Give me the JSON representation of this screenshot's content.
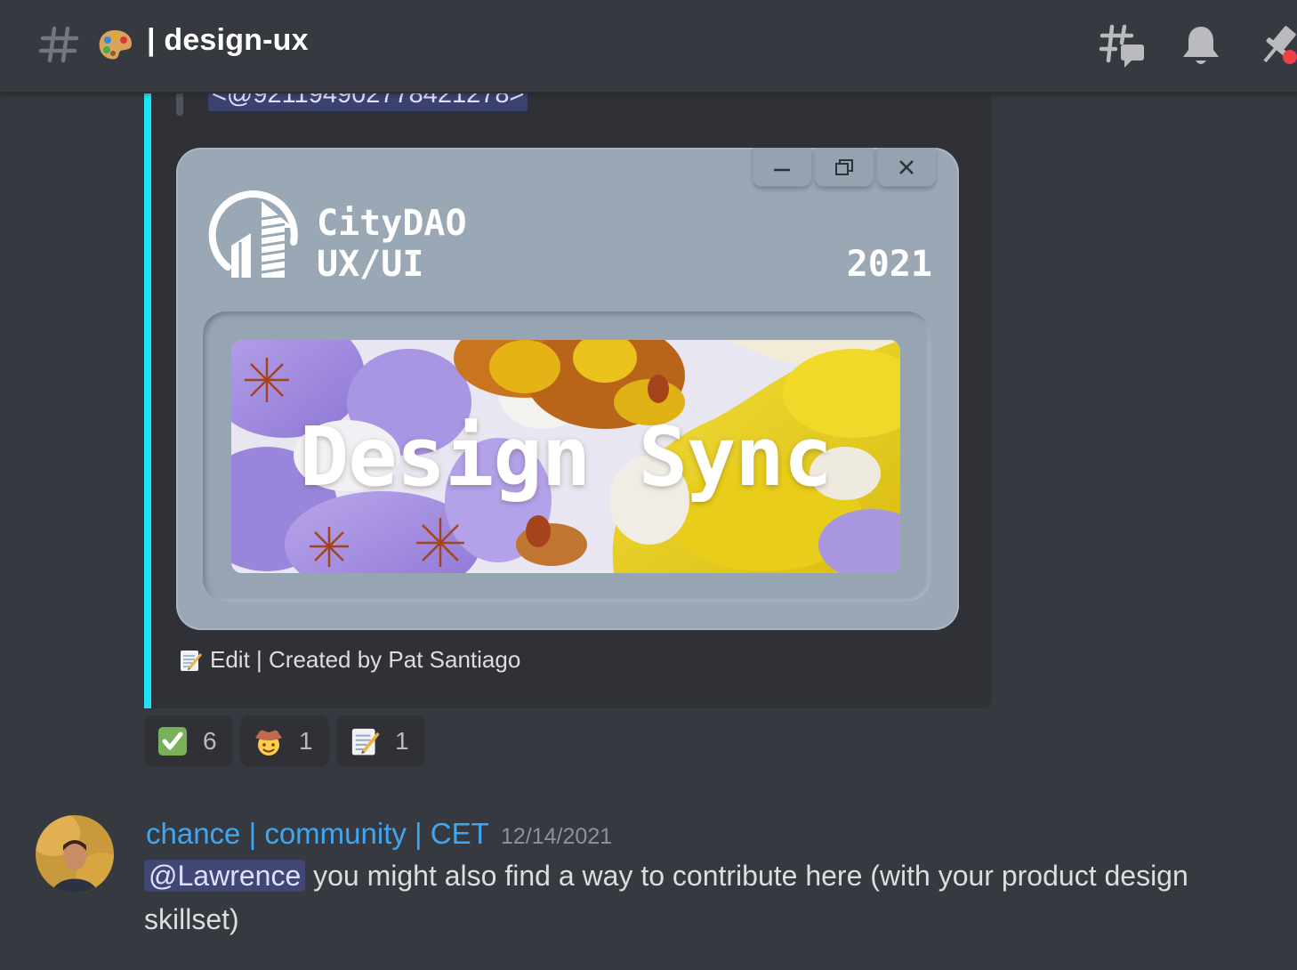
{
  "header": {
    "channel_label": "| design-ux",
    "icons": [
      "text-channel-hash-icon",
      "artist-palette-emoji",
      "threads-icon",
      "notification-bell-icon",
      "pinned-messages-icon"
    ]
  },
  "embed": {
    "accent_color": "#1de4f6",
    "mention_id": "<@921194902778421278>",
    "image": {
      "brand_line_1": "CityDAO",
      "brand_line_2": "UX/UI",
      "year": "2021",
      "banner_title": "Design Sync",
      "window_controls": [
        "minimize-icon",
        "restore-icon",
        "close-icon"
      ]
    },
    "footer_text": "Edit | Created by Pat Santiago",
    "footer_icon": "memo-emoji"
  },
  "reactions": [
    {
      "emoji": "check-mark-button-emoji",
      "count": "6"
    },
    {
      "emoji": "cowboy-face-emoji",
      "count": "1"
    },
    {
      "emoji": "memo-emoji",
      "count": "1"
    }
  ],
  "message": {
    "author": "chance | community | CET",
    "author_color": "#3fa6ef",
    "timestamp": "12/14/2021",
    "mention": "@Lawrence",
    "text": " you might also find a way to contribute here (with your product design skillset)"
  }
}
